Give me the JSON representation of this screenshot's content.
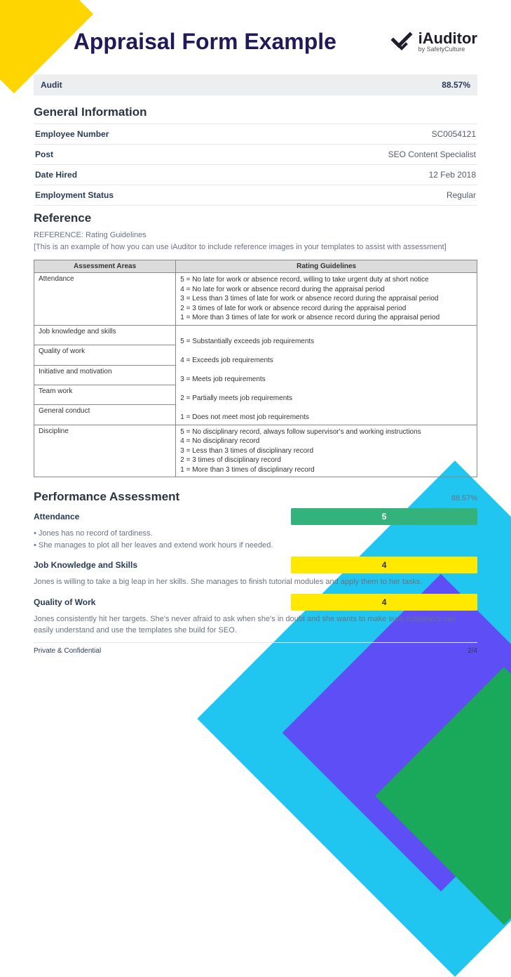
{
  "header": {
    "title": "Appraisal Form Example",
    "logo_main": "iAuditor",
    "logo_sub": "by SafetyCulture"
  },
  "audit": {
    "label": "Audit",
    "percent": "88.57%"
  },
  "general": {
    "title": "General Information",
    "rows": [
      {
        "label": "Employee Number",
        "value": "SC0054121"
      },
      {
        "label": "Post",
        "value": "SEO Content Specialist"
      },
      {
        "label": "Date Hired",
        "value": "12 Feb 2018"
      },
      {
        "label": "Employment Status",
        "value": "Regular"
      }
    ]
  },
  "reference": {
    "title": "Reference",
    "caption_line1": "REFERENCE: Rating Guidelines",
    "caption_line2": "[This is an example of how you can use iAuditor to include reference images in your templates to assist with assessment]",
    "th_area": "Assessment Areas",
    "th_guide": "Rating Guidelines",
    "rows": [
      {
        "area": "Attendance",
        "guide": "5 = No late for work or absence record, willing to take urgent duty at short notice\n4 = No late for work or absence record during the appraisal period\n3 = Less than 3 times of late for work or absence record during the appraisal period\n2 = 3 times of late for work or absence record during the appraisal period\n1 = More than 3 times of late for work or absence record during the appraisal period"
      },
      {
        "area": "Job knowledge and skills",
        "guide": "5 = Substantially exceeds job requirements"
      },
      {
        "area": "Quality of work",
        "guide": "4 = Exceeds job requirements"
      },
      {
        "area": "Initiative and motivation",
        "guide": "3 = Meets job requirements"
      },
      {
        "area": "Team work",
        "guide": "2 = Partially meets job requirements"
      },
      {
        "area": "General conduct",
        "guide": "1 = Does not meet most job requirements"
      },
      {
        "area": "Discipline",
        "guide": "5 = No disciplinary record, always follow supervisor's and working instructions\n4 = No disciplinary record\n3 = Less than 3 times of disciplinary record\n2 = 3 times of disciplinary record\n1 = More than 3 times of disciplinary record"
      }
    ]
  },
  "performance": {
    "title": "Performance Assessment",
    "percent": "88.57%",
    "items": [
      {
        "label": "Attendance",
        "score": "5",
        "score_class": "green",
        "note1": "Jones has no record of tardiness.",
        "note2": "She manages to plot all her leaves and extend work hours if needed."
      },
      {
        "label": "Job Knowledge and Skills",
        "score": "4",
        "score_class": "yellow",
        "note1": "Jones is willing to take a big leap in her skills. She manages to finish tutorial modules and apply them to her tasks."
      },
      {
        "label": "Quality of Work",
        "score": "4",
        "score_class": "yellow",
        "note1": "Jones consistently hit her targets. She's never afraid to ask when she's in doubt and she wants to make sure customers can easily understand and use the templates she build for SEO."
      }
    ]
  },
  "footer": {
    "left": "Private & Confidential",
    "right": "2/4"
  }
}
